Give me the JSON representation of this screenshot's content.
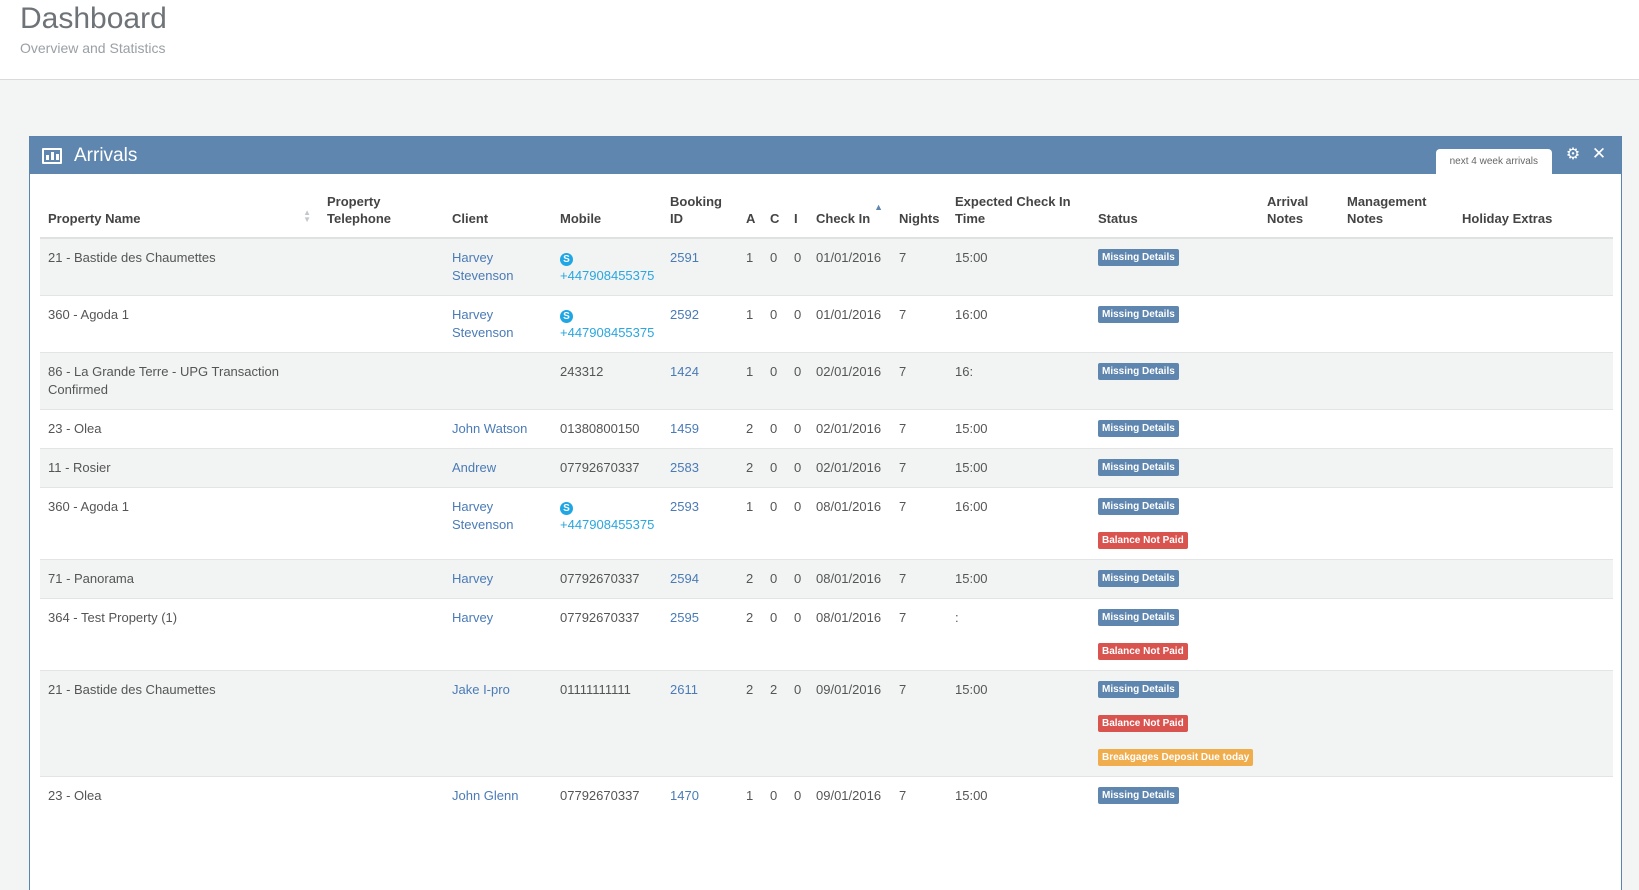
{
  "header": {
    "title": "Dashboard",
    "subtitle": "Overview and Statistics"
  },
  "colors": {
    "accent": "#5e86af",
    "danger": "#d9534f",
    "warning": "#f0ad4e",
    "link": "#4a7bb7",
    "skype": "#1fa6e5"
  },
  "arrivals": {
    "title": "Arrivals",
    "icon": "bar-chart-icon",
    "tab_label": "next 4 week arrivals",
    "tools": [
      "gear-icon",
      "close-icon"
    ],
    "columns": [
      {
        "key": "property",
        "label": "Property Name",
        "sort": "both"
      },
      {
        "key": "telephone",
        "label": "Property Telephone"
      },
      {
        "key": "client",
        "label": "Client"
      },
      {
        "key": "mobile",
        "label": "Mobile"
      },
      {
        "key": "booking_id",
        "label": "Booking ID"
      },
      {
        "key": "a",
        "label": "A"
      },
      {
        "key": "c",
        "label": "C"
      },
      {
        "key": "i",
        "label": "I"
      },
      {
        "key": "check_in",
        "label": "Check In",
        "sort": "asc"
      },
      {
        "key": "nights",
        "label": "Nights"
      },
      {
        "key": "expected_time",
        "label": "Expected Check In Time"
      },
      {
        "key": "status",
        "label": "Status"
      },
      {
        "key": "arrival_notes",
        "label": "Arrival Notes"
      },
      {
        "key": "management_notes",
        "label": "Management Notes"
      },
      {
        "key": "holiday_extras",
        "label": "Holiday Extras"
      }
    ],
    "rows": [
      {
        "property": "21 - Bastide des Chaumettes",
        "telephone": "",
        "client": "Harvey Stevenson",
        "mobile": "+447908455375",
        "mobile_skype": true,
        "booking_id": "2591",
        "a": "1",
        "c": "0",
        "i": "0",
        "check_in": "01/01/2016",
        "nights": "7",
        "expected_time": "15:00",
        "status": [
          "Missing Details"
        ]
      },
      {
        "property": "360 - Agoda 1",
        "telephone": "",
        "client": "Harvey Stevenson",
        "mobile": "+447908455375",
        "mobile_skype": true,
        "booking_id": "2592",
        "a": "1",
        "c": "0",
        "i": "0",
        "check_in": "01/01/2016",
        "nights": "7",
        "expected_time": "16:00",
        "status": [
          "Missing Details"
        ]
      },
      {
        "property": "86 - La Grande Terre - UPG Transaction Confirmed",
        "telephone": "",
        "client": "",
        "mobile": "243312",
        "mobile_skype": false,
        "booking_id": "1424",
        "a": "1",
        "c": "0",
        "i": "0",
        "check_in": "02/01/2016",
        "nights": "7",
        "expected_time": "16:",
        "status": [
          "Missing Details"
        ]
      },
      {
        "property": "23 - Olea",
        "telephone": "",
        "client": "John Watson",
        "mobile": "01380800150",
        "mobile_skype": false,
        "booking_id": "1459",
        "a": "2",
        "c": "0",
        "i": "0",
        "check_in": "02/01/2016",
        "nights": "7",
        "expected_time": "15:00",
        "status": [
          "Missing Details"
        ]
      },
      {
        "property": "11 - Rosier",
        "telephone": "",
        "client": "Andrew",
        "mobile": "07792670337",
        "mobile_skype": false,
        "booking_id": "2583",
        "a": "2",
        "c": "0",
        "i": "0",
        "check_in": "02/01/2016",
        "nights": "7",
        "expected_time": "15:00",
        "status": [
          "Missing Details"
        ]
      },
      {
        "property": "360 - Agoda 1",
        "telephone": "",
        "client": "Harvey Stevenson",
        "mobile": "+447908455375",
        "mobile_skype": true,
        "booking_id": "2593",
        "a": "1",
        "c": "0",
        "i": "0",
        "check_in": "08/01/2016",
        "nights": "7",
        "expected_time": "16:00",
        "status": [
          "Missing Details",
          "Balance Not Paid"
        ]
      },
      {
        "property": "71 - Panorama",
        "telephone": "",
        "client": "Harvey",
        "mobile": "07792670337",
        "mobile_skype": false,
        "booking_id": "2594",
        "a": "2",
        "c": "0",
        "i": "0",
        "check_in": "08/01/2016",
        "nights": "7",
        "expected_time": "15:00",
        "status": [
          "Missing Details"
        ]
      },
      {
        "property": "364 - Test Property (1)",
        "telephone": "",
        "client": "Harvey",
        "mobile": "07792670337",
        "mobile_skype": false,
        "booking_id": "2595",
        "a": "2",
        "c": "0",
        "i": "0",
        "check_in": "08/01/2016",
        "nights": "7",
        "expected_time": ":",
        "status": [
          "Missing Details",
          "Balance Not Paid"
        ]
      },
      {
        "property": "21 - Bastide des Chaumettes",
        "telephone": "",
        "client": "Jake I-pro",
        "mobile": "01111111111",
        "mobile_skype": false,
        "booking_id": "2611",
        "a": "2",
        "c": "2",
        "i": "0",
        "check_in": "09/01/2016",
        "nights": "7",
        "expected_time": "15:00",
        "status": [
          "Missing Details",
          "Balance Not Paid",
          "Breakgages Deposit Due today"
        ]
      },
      {
        "property": "23 - Olea",
        "telephone": "",
        "client": "John Glenn",
        "mobile": "07792670337",
        "mobile_skype": false,
        "booking_id": "1470",
        "a": "1",
        "c": "0",
        "i": "0",
        "check_in": "09/01/2016",
        "nights": "7",
        "expected_time": "15:00",
        "status": [
          "Missing Details"
        ]
      }
    ]
  }
}
